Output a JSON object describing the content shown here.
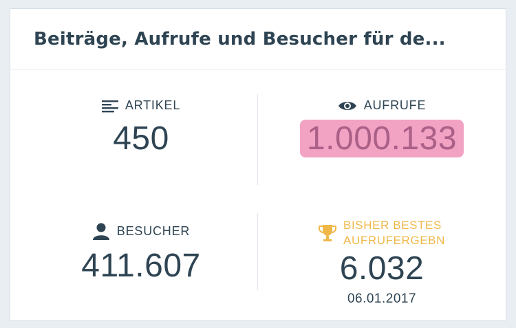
{
  "header": {
    "title": "Beiträge, Aufrufe und Besucher für de..."
  },
  "stats": {
    "articles": {
      "label": "ARTIKEL",
      "value": "450",
      "icon": "posts-icon"
    },
    "views": {
      "label": "AUFRUFE",
      "value": "1.000.133",
      "icon": "eye-icon",
      "highlight_color": "#f2a2c3"
    },
    "visitors": {
      "label": "BESUCHER",
      "value": "411.607",
      "icon": "person-icon"
    },
    "best": {
      "label_line1": "BISHER BESTES",
      "label_line2": "AUFRUFERGEBN",
      "value": "6.032",
      "date": "06.01.2017",
      "icon": "trophy-icon",
      "label_color": "#f0b849"
    }
  }
}
